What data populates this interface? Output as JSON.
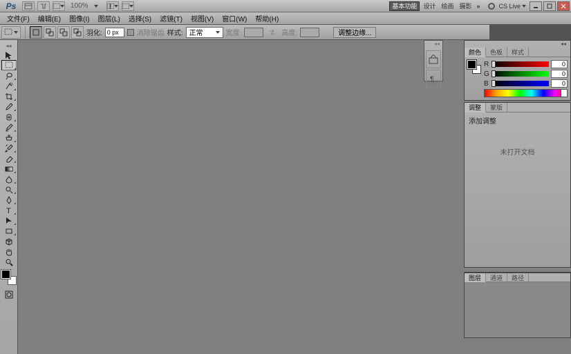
{
  "titlebar": {
    "logo": "Ps",
    "zoom": "100%",
    "workspaces": {
      "active": "基本功能",
      "design": "设计",
      "painting": "绘画",
      "photography": "摄影"
    },
    "cslive": "CS Live"
  },
  "menu": {
    "file": "文件(F)",
    "edit": "编辑(E)",
    "image": "图像(I)",
    "layer": "图层(L)",
    "select": "选择(S)",
    "filter": "滤镜(T)",
    "view": "视图(V)",
    "window": "窗口(W)",
    "help": "帮助(H)"
  },
  "options": {
    "feather_label": "羽化:",
    "feather_value": "0 px",
    "antialias": "消除锯齿",
    "style_label": "样式:",
    "style_value": "正常",
    "width_label": "宽度:",
    "height_label": "高度:",
    "adjust_edge": "调整边缘..."
  },
  "color_panel": {
    "tabs": {
      "color": "颜色",
      "swatch": "色板",
      "styles": "样式"
    },
    "r_label": "R",
    "g_label": "G",
    "b_label": "B",
    "r": "0",
    "g": "0",
    "b": "0"
  },
  "adjust_panel": {
    "tabs": {
      "adjust": "调整",
      "mask": "蒙版"
    },
    "add_adjust": "添加调整",
    "no_doc": "未打开文档"
  },
  "layers_panel": {
    "tabs": {
      "layers": "图层",
      "channels": "通道",
      "paths": "路径"
    }
  }
}
